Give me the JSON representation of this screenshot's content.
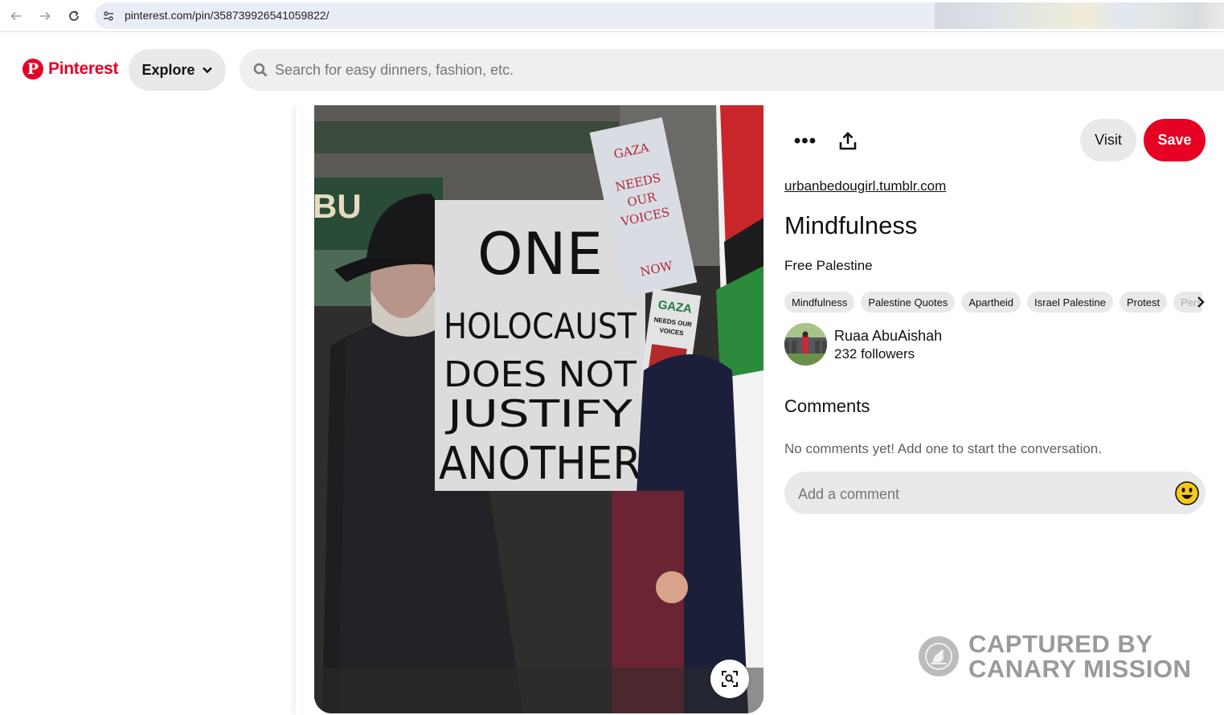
{
  "browser": {
    "url": "pinterest.com/pin/358739926541059822/"
  },
  "header": {
    "logo_text": "Pinterest",
    "logo_mark": "P",
    "explore_label": "Explore",
    "search_placeholder": "Search for easy dinners, fashion, etc."
  },
  "pin": {
    "image_sign_text": [
      "ONE",
      "HOLOCAUST",
      "DOES NOT",
      "JUSTIFY",
      "ANOTHER"
    ],
    "image_sign2_text": [
      "GAZA",
      "NEEDS",
      "OUR",
      "VOICES",
      "NOW"
    ],
    "image_sign3_text": [
      "GAZA",
      "NEEDS OUR",
      "VOICES"
    ],
    "more_label": "•••",
    "visit_label": "Visit",
    "save_label": "Save",
    "source": "urbanbedougirl.tumblr.com",
    "title": "Mindfulness",
    "description": "Free Palestine",
    "tags": [
      "Mindfulness",
      "Palestine Quotes",
      "Apartheid",
      "Israel Palestine",
      "Protest",
      "Pers"
    ]
  },
  "creator": {
    "name": "Ruaa AbuAishah",
    "followers": "232 followers"
  },
  "comments": {
    "heading": "Comments",
    "empty_text": "No comments yet! Add one to start the conversation.",
    "placeholder": "Add a comment"
  },
  "watermark": {
    "line1": "CAPTURED BY",
    "line2": "CANARY MISSION"
  },
  "colors": {
    "brand": "#e60023",
    "pill_bg": "#e9e9e9"
  }
}
